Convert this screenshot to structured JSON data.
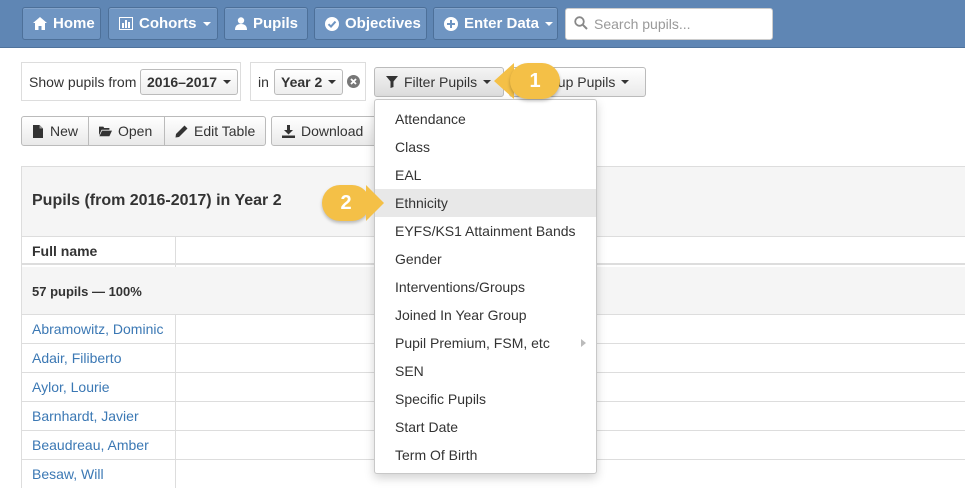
{
  "nav": {
    "home": "Home",
    "cohorts": "Cohorts",
    "pupils": "Pupils",
    "objectives": "Objectives",
    "enter_data": "Enter Data",
    "search_placeholder": "Search pupils..."
  },
  "filters": {
    "show_from_label": "Show pupils from",
    "year_range": "2016–2017",
    "in_label": "in",
    "year_group": "Year 2",
    "filter_button": "Filter Pupils",
    "group_button_visible": "oup Pupils"
  },
  "toolbar": {
    "new": "New",
    "open": "Open",
    "edit_table": "Edit Table",
    "download": "Download"
  },
  "table": {
    "title": "Pupils (from 2016-2017) in Year 2",
    "col_full_name": "Full name",
    "summary": "57 pupils — 100%",
    "rows": [
      "Abramowitz, Dominic",
      "Adair, Filiberto",
      "Aylor, Lourie",
      "Barnhardt, Javier",
      "Beaudreau, Amber",
      "Besaw, Will"
    ]
  },
  "dropdown": {
    "items": [
      "Attendance",
      "Class",
      "EAL",
      "Ethnicity",
      "EYFS/KS1 Attainment Bands",
      "Gender",
      "Interventions/Groups",
      "Joined In Year Group",
      "Pupil Premium, FSM, etc",
      "SEN",
      "Specific Pupils",
      "Start Date",
      "Term Of Birth"
    ],
    "active_item": "Ethnicity"
  },
  "callouts": {
    "step1": "1",
    "step2": "2"
  },
  "colors": {
    "navbar": "#5f86b4",
    "link": "#3b78b4",
    "callout": "#f4c047"
  }
}
